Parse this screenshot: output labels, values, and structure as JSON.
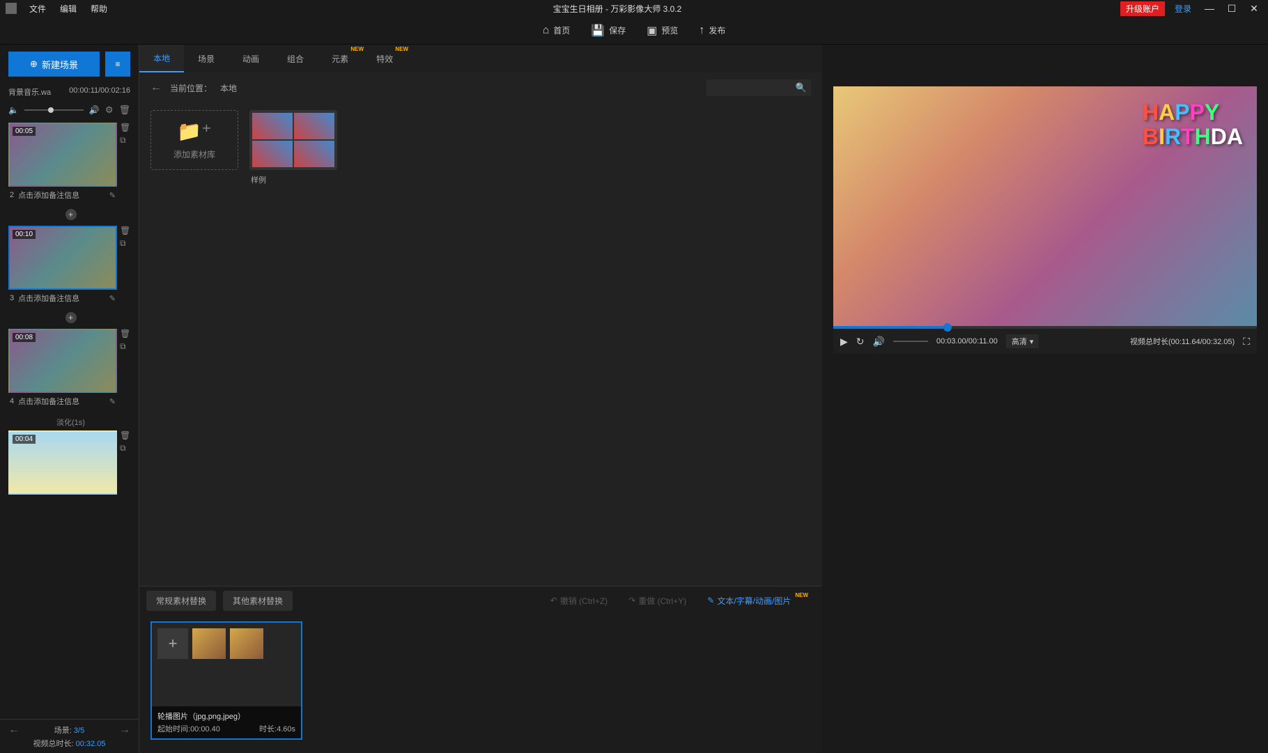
{
  "titlebar": {
    "menus": [
      "文件",
      "编辑",
      "帮助"
    ],
    "title": "宝宝生日相册 - 万彩影像大师 3.0.2",
    "upgrade": "升级账户",
    "login": "登录"
  },
  "toolbar": {
    "home": "首页",
    "save": "保存",
    "preview": "预览",
    "publish": "发布"
  },
  "left": {
    "new_scene": "新建场景",
    "bg_music_file": "背景音乐.wa",
    "bg_music_time": "00:00:11/00:02:16",
    "scenes": [
      {
        "num": "2",
        "dur": "00:05",
        "note": "点击添加备注信息"
      },
      {
        "num": "3",
        "dur": "00:10",
        "note": "点击添加备注信息",
        "selected": true
      },
      {
        "num": "4",
        "dur": "00:08",
        "note": "点击添加备注信息"
      }
    ],
    "transition": "淡化(1s)",
    "scene5_dur": "00:04",
    "footer": {
      "scene_label": "场景:",
      "scene_val": "3/5",
      "total_label": "视频总时长:",
      "total_val": "00:32.05"
    }
  },
  "center": {
    "tabs": [
      {
        "label": "本地",
        "active": true
      },
      {
        "label": "场景"
      },
      {
        "label": "动画"
      },
      {
        "label": "组合"
      },
      {
        "label": "元素",
        "new": true
      },
      {
        "label": "特效",
        "new": true
      }
    ],
    "breadcrumb_label": "当前位置：",
    "breadcrumb_val": "本地",
    "add_library": "添加素材库",
    "sample": "样例",
    "bottom_tabs": {
      "regular": "常规素材替换",
      "other": "其他素材替换",
      "undo": "撤销 (Ctrl+Z)",
      "redo": "重做 (Ctrl+Y)",
      "text_anim": "文本/字幕/动画/图片"
    },
    "slot": {
      "title": "轮播图片（jpg,png,jpeg）",
      "start_label": "起始时间:",
      "start_val": "00:00.40",
      "dur_label": "时长:",
      "dur_val": "4.60s"
    }
  },
  "preview": {
    "happy": "HAPPY",
    "birthday": "BIRTHDA",
    "time_current": "00:03.00/00:11.00",
    "quality": "高清",
    "total_label": "视频总时长(",
    "total_val": "00:11.64/00:32.05",
    "total_close": ")"
  }
}
